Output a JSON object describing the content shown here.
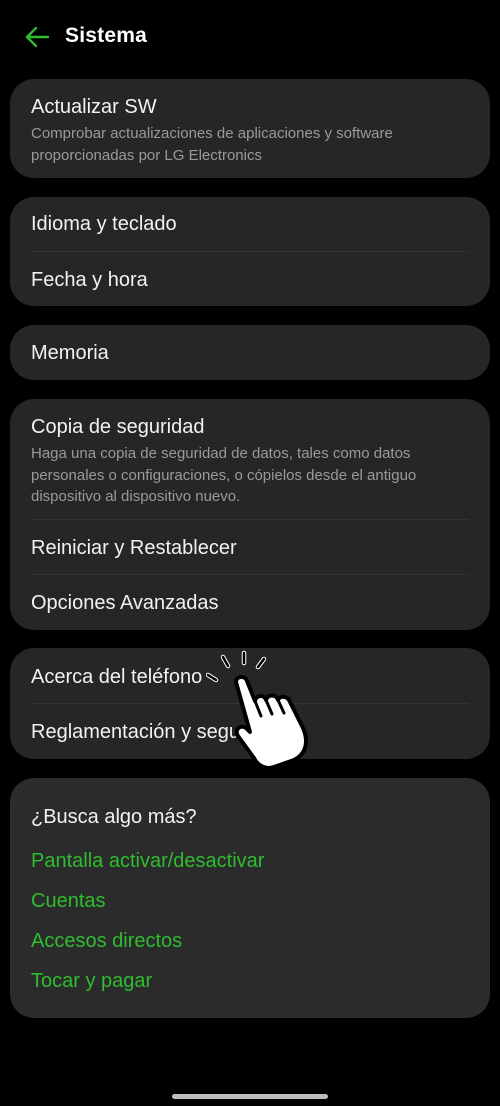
{
  "header": {
    "title": "Sistema",
    "back_icon": "arrow-left-icon",
    "accent_color": "#2ebd2e"
  },
  "update": {
    "title": "Actualizar SW",
    "subtitle": "Comprobar actualizaciones de aplicaciones y software proporcionadas por LG Electronics"
  },
  "language": {
    "items": [
      "Idioma y teclado",
      "Fecha y hora"
    ]
  },
  "memory": {
    "title": "Memoria"
  },
  "backup": {
    "title": "Copia de seguridad",
    "subtitle": "Haga una copia de seguridad de datos, tales como datos personales o configuraciones, o cópielos desde el antiguo dispositivo al dispositivo nuevo.",
    "items": [
      "Reiniciar y Restablecer",
      "Opciones Avanzadas"
    ]
  },
  "about": {
    "items": [
      "Acerca del teléfono",
      "Reglamentación y seguridad"
    ]
  },
  "search_more": {
    "title": "¿Busca algo más?",
    "links": [
      "Pantalla activar/desactivar",
      "Cuentas",
      "Accesos directos",
      "Tocar y pagar"
    ]
  },
  "overlay": {
    "icon": "tap-hand-icon"
  }
}
